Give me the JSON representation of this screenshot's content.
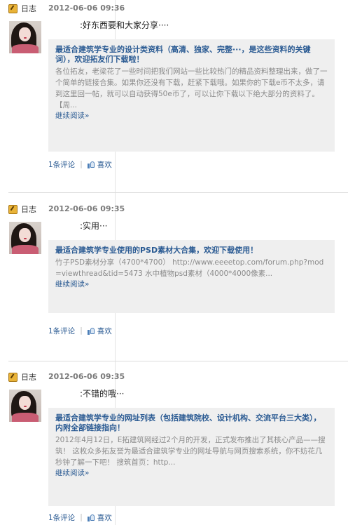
{
  "entries": [
    {
      "type_label": "日志",
      "date": "2012-06-06 09:36",
      "note": ":好东西要和大家分享····",
      "title": "最适合建筑学专业的设计类资料（高清、独家、完整···，是这些资料的关键词），欢迎拓友们下载啦！",
      "body": "各位拓友，老梁花了一些时间把我们网站一些比较热门的精品资料整理出来，做了一个简单的链接合集。如果你还没有下载，赶紧下载哦。如果你的下载e币不太多，请到这里回一帖，就可以自动获得50e币了，可以让你下载以下绝大部分的资料了。 【周...",
      "more": "继续阅读»",
      "comments": "1条评论",
      "like": "喜欢"
    },
    {
      "type_label": "日志",
      "date": "2012-06-06 09:35",
      "note": ":实用···",
      "title": "最适合建筑学专业使用的PSD素材大合集，欢迎下载使用！",
      "body": "竹子PSD素材分享（4700*4700） http://www.eeeetop.com/forum.php?mod=viewthread&tid=5473 水中植物psd素材（4000*4000像素...",
      "more": "继续阅读»",
      "comments": "1条评论",
      "like": "喜欢"
    },
    {
      "type_label": "日志",
      "date": "2012-06-06 09:35",
      "note": ":不错的哦···",
      "title": "最适合建筑学专业的网址列表（包括建筑院校、设计机构、交流平台三大类），内附全部链接指向！",
      "body": "2012年4月12日，E拓建筑网经过2个月的开发，正式发布推出了其核心产品——搜筑！ 这枚众多拓友誉为最适合建筑学专业的网址导航与网页搜索系统，你不妨花几秒钟了解一下吧！ 搜筑首页：http...",
      "more": "继续阅读»",
      "comments": "1条评论",
      "like": "喜欢"
    }
  ]
}
